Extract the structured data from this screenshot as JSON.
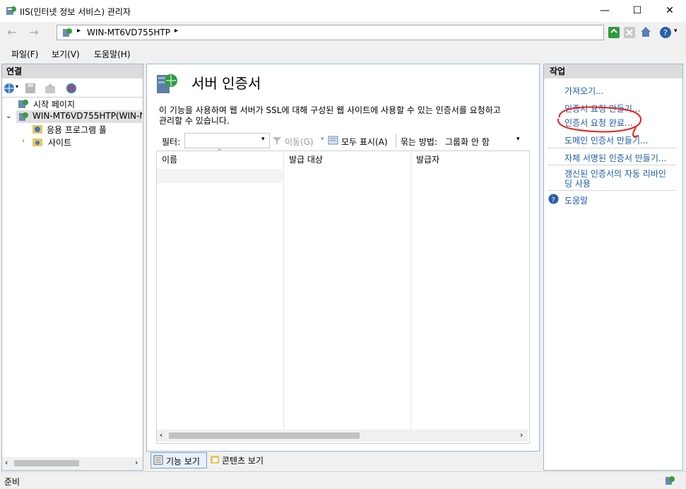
{
  "window": {
    "title": "IIS(인터넷 정보 서비스) 관리자",
    "minimize": "—",
    "maximize": "☐",
    "close": "✕"
  },
  "address": {
    "path": "WIN-MT6VD755HTP",
    "sep": "▸"
  },
  "menu": {
    "file": "파일(F)",
    "view": "보기(V)",
    "help": "도움말(H)"
  },
  "connections": {
    "title": "연결",
    "tree": {
      "start_page": "시작 페이지",
      "server": "WIN-MT6VD755HTP(WIN-M",
      "app_pools": "응용 프로그램 풀",
      "sites": "사이트"
    }
  },
  "feature": {
    "title": "서버 인증서",
    "description_line1": "이 기능을 사용하여 웹 서버가 SSL에 대해 구성된 웹 사이트에 사용할 수 있는 인증서를 요청하고",
    "description_line2": "관리할 수 있습니다.",
    "filter_label": "필터:",
    "filter_value": "",
    "go_label": "이동(G)",
    "show_all_label": "모두 표시(A)",
    "group_label": "묶는 방법:",
    "group_value": "그룹화 안 함",
    "columns": [
      "이름",
      "발급 대상",
      "발급자"
    ]
  },
  "view_tabs": {
    "features": "기능 보기",
    "content": "콘텐츠 보기"
  },
  "actions": {
    "title": "작업",
    "import": "가져오기...",
    "create_request": "인증서 요청 만들기...",
    "complete_request": "인증서 요청 완료...",
    "domain_cert": "도메인 인증서 만들기...",
    "self_signed": "자체 서명된 인증서 만들기...",
    "auto_rebind_line1": "갱신된 인증서의 자동 리바인",
    "auto_rebind_line2": "딩 사용",
    "help": "도움말"
  },
  "status": {
    "text": "준비"
  },
  "colors": {
    "link": "#1a5aa8",
    "annotation": "#e8211d",
    "panel_border": "#9fb6cd"
  }
}
